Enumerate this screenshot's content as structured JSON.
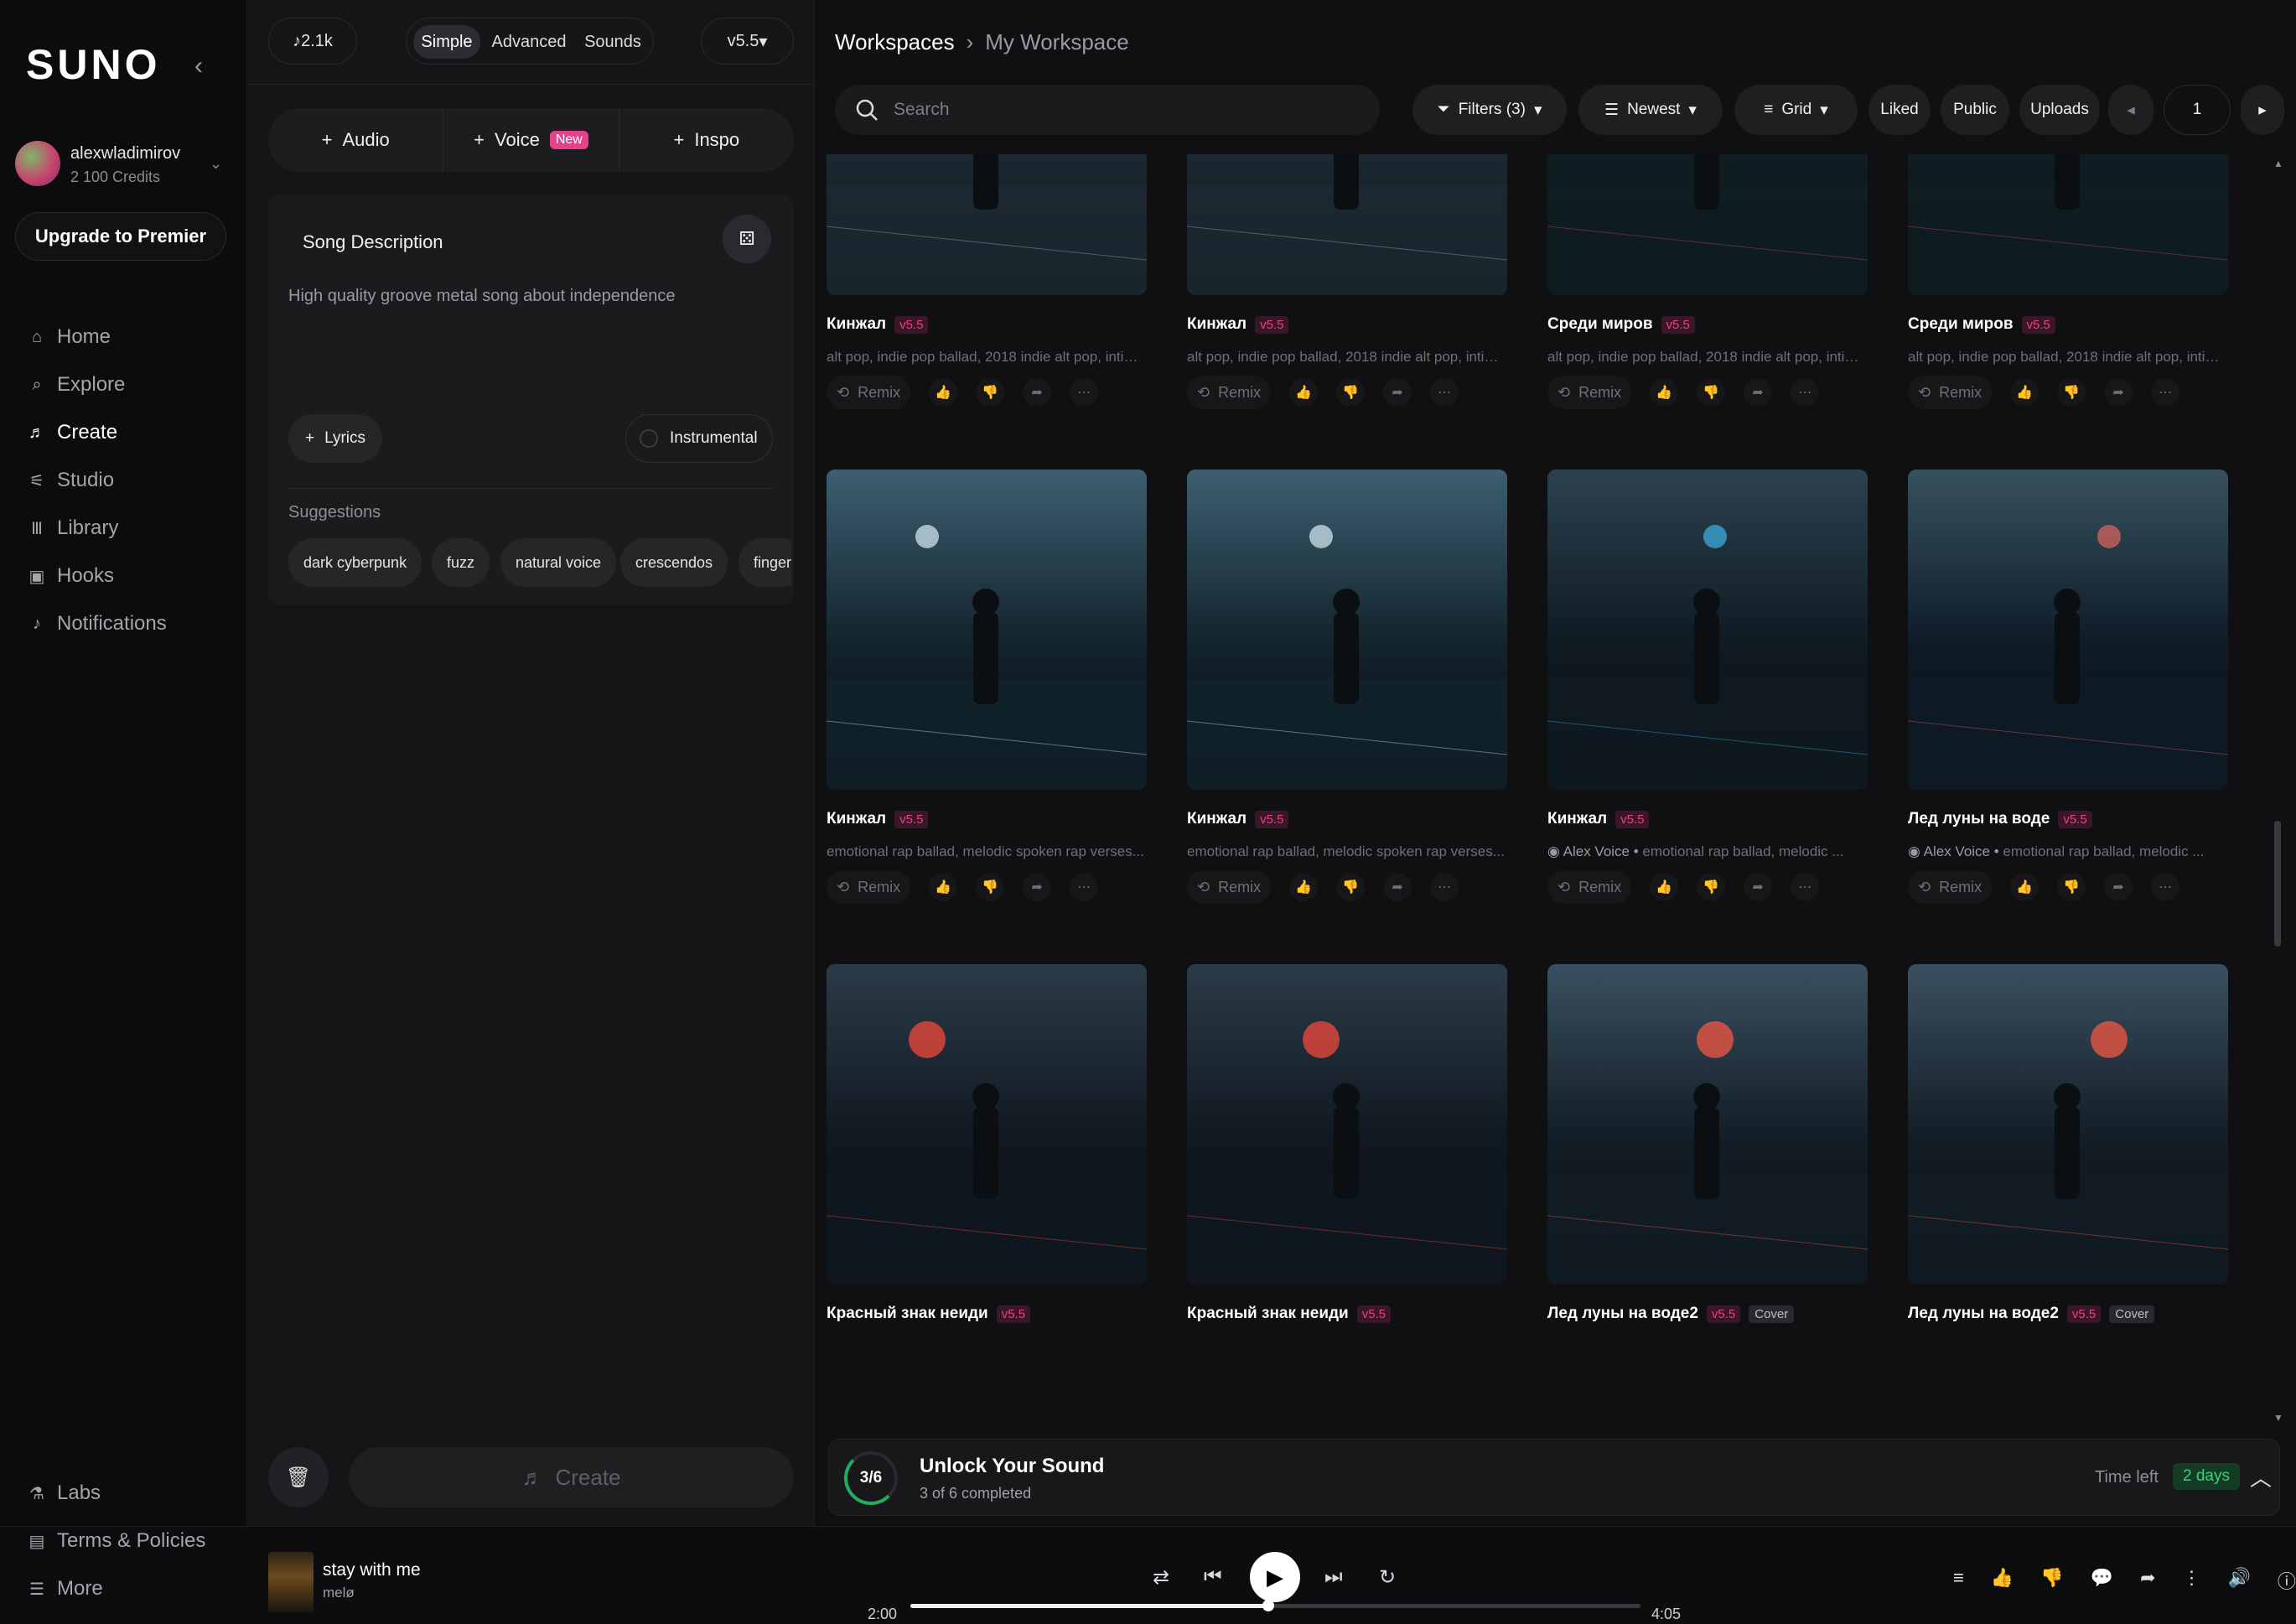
{
  "sidebar": {
    "logo": "SUNO",
    "user": {
      "name": "alexwladimirov",
      "credits": "2 100 Credits"
    },
    "upgrade_label": "Upgrade to Premier",
    "nav": [
      {
        "label": "Home",
        "icon": "home-icon"
      },
      {
        "label": "Explore",
        "icon": "search-icon"
      },
      {
        "label": "Create",
        "icon": "music-note-icon"
      },
      {
        "label": "Studio",
        "icon": "studio-icon"
      },
      {
        "label": "Library",
        "icon": "library-icon"
      },
      {
        "label": "Hooks",
        "icon": "hooks-icon"
      },
      {
        "label": "Notifications",
        "icon": "bell-icon"
      }
    ],
    "bottom": [
      {
        "label": "Labs",
        "icon": "flask-icon"
      },
      {
        "label": "Terms & Policies",
        "icon": "document-icon"
      },
      {
        "label": "More",
        "icon": "menu-icon"
      }
    ]
  },
  "create": {
    "count_label": "2.1k",
    "modes": [
      "Simple",
      "Advanced",
      "Sounds"
    ],
    "selected_mode": "Simple",
    "model": "v5.5",
    "add": {
      "audio": "Audio",
      "voice": "Voice",
      "voice_badge": "New",
      "inspo": "Inspo"
    },
    "description_title": "Song Description",
    "description_text": "High quality groove metal song about independence",
    "lyrics_label": "Lyrics",
    "instrumental_label": "Instrumental",
    "suggestions_title": "Suggestions",
    "suggestions": [
      "dark cyberpunk",
      "fuzz",
      "natural voice",
      "crescendos",
      "finger"
    ],
    "create_label": "Create"
  },
  "workspace": {
    "breadcrumb": [
      "Workspaces",
      "My Workspace"
    ],
    "search_placeholder": "Search",
    "filters_label": "Filters (3)",
    "sort_label": "Newest",
    "view_label": "Grid",
    "liked_label": "Liked",
    "public_label": "Public",
    "uploads_label": "Uploads",
    "page": "1"
  },
  "songs": [
    {
      "title": "Кинжал",
      "badge": "v5.5",
      "tags": "alt pop, indie pop ballad, 2018 indie alt pop, intim...",
      "remix": "Remix"
    },
    {
      "title": "Кинжал",
      "badge": "v5.5",
      "tags": "alt pop, indie pop ballad, 2018 indie alt pop, intim...",
      "remix": "Remix"
    },
    {
      "title": "Среди миров",
      "badge": "v5.5",
      "tags": "alt pop, indie pop ballad, 2018 indie alt pop, intim...",
      "remix": "Remix"
    },
    {
      "title": "Среди миров",
      "badge": "v5.5",
      "tags": "alt pop, indie pop ballad, 2018 indie alt pop, intim...",
      "remix": "Remix"
    },
    {
      "title": "Кинжал",
      "badge": "v5.5",
      "tags": "emotional rap ballad, melodic spoken rap verses...",
      "remix": "Remix"
    },
    {
      "title": "Кинжал",
      "badge": "v5.5",
      "tags": "emotional rap ballad, melodic spoken rap verses...",
      "remix": "Remix"
    },
    {
      "title": "Кинжал",
      "badge": "v5.5",
      "voice": "Alex Voice",
      "tags": "emotional rap ballad, melodic ...",
      "remix": "Remix"
    },
    {
      "title": "Лед луны на воде",
      "badge": "v5.5",
      "voice": "Alex Voice",
      "tags": "emotional rap ballad, melodic ...",
      "remix": "Remix"
    },
    {
      "title": "Красный знак неиди",
      "badge": "v5.5"
    },
    {
      "title": "Красный знак неиди",
      "badge": "v5.5"
    },
    {
      "title": "Лед луны на воде2",
      "badge": "v5.5",
      "cover": "Cover"
    },
    {
      "title": "Лед луны на воде2",
      "badge": "v5.5",
      "cover": "Cover"
    }
  ],
  "unlock": {
    "progress": "3/6",
    "title": "Unlock Your Sound",
    "subtitle": "3 of 6 completed",
    "time_left_label": "Time left",
    "days": "2 days"
  },
  "player": {
    "title": "stay with me",
    "artist": "melø",
    "current_time": "2:00",
    "total_time": "4:05",
    "progress_fraction": 0.49
  }
}
